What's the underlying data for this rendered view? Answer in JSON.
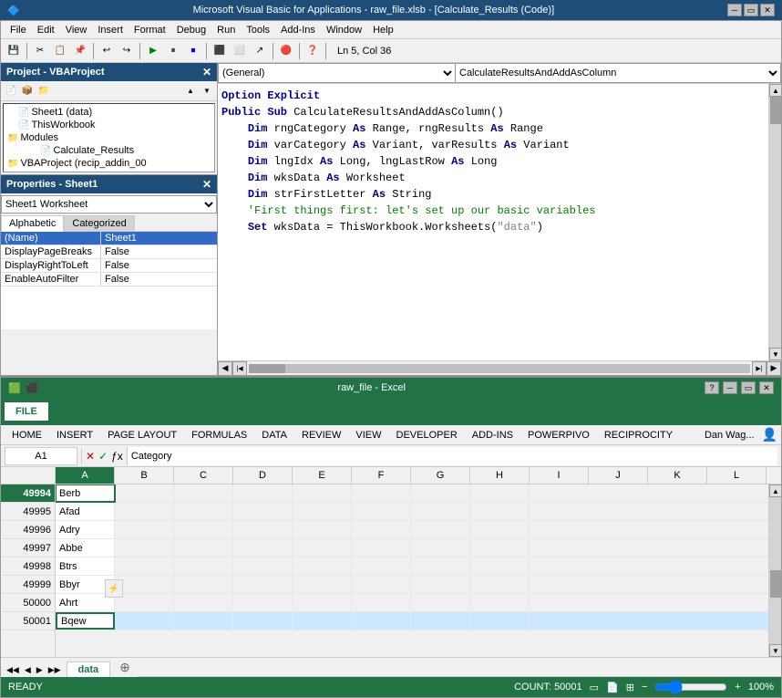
{
  "titlebar": {
    "text": "Microsoft Visual Basic for Applications - raw_file.xlsb - [Calculate_Results (Code)]",
    "controls": [
      "minimize",
      "restore",
      "close"
    ]
  },
  "vba": {
    "menubar": {
      "items": [
        "File",
        "Edit",
        "View",
        "Insert",
        "Format",
        "Debug",
        "Run",
        "Tools",
        "Add-Ins",
        "Window",
        "Help"
      ]
    },
    "toolbar": {
      "status": "Ln 5, Col 36"
    },
    "project_panel": {
      "title": "Project - VBAProject",
      "tree": [
        {
          "label": "Sheet1 (data)",
          "indent": 1,
          "icon": "📄"
        },
        {
          "label": "ThisWorkbook",
          "indent": 1,
          "icon": "📄"
        },
        {
          "label": "Modules",
          "indent": 0,
          "icon": "📁"
        },
        {
          "label": "Calculate_Results",
          "indent": 2,
          "icon": "📄"
        },
        {
          "label": "VBAProject (recip_addin_00",
          "indent": 0,
          "icon": "📁"
        }
      ]
    },
    "properties_panel": {
      "title": "Properties - Sheet1",
      "dropdown": "Sheet1  Worksheet",
      "tabs": [
        "Alphabetic",
        "Categorized"
      ],
      "active_tab": "Alphabetic",
      "rows": [
        {
          "name": "(Name)",
          "value": "Sheet1",
          "selected": true
        },
        {
          "name": "DisplayPageBreaks",
          "value": "False"
        },
        {
          "name": "DisplayRightToLeft",
          "value": "False"
        },
        {
          "name": "EnableAutoFilter",
          "value": "False"
        }
      ]
    },
    "code_editor": {
      "dropdown_left": "(General)",
      "dropdown_right": "CalculateResultsAndAddAsColumn",
      "lines": [
        {
          "text": "Option Explicit",
          "type": "keyword"
        },
        {
          "text": "Public Sub CalculateResultsAndAddAsColumn()",
          "type": "mixed"
        },
        {
          "text": "",
          "type": "normal"
        },
        {
          "text": "    Dim rngCategory As Range, rngResults As Range",
          "type": "mixed"
        },
        {
          "text": "    Dim varCategory As Variant, varResults As Variant",
          "type": "mixed"
        },
        {
          "text": "    Dim lngIdx As Long, lngLastRow As Long",
          "type": "mixed"
        },
        {
          "text": "    Dim wksData As Worksheet",
          "type": "mixed"
        },
        {
          "text": "    Dim strFirstLetter As String",
          "type": "mixed"
        },
        {
          "text": "",
          "type": "normal"
        },
        {
          "text": "    'First things first: let's set up our basic variables",
          "type": "comment"
        },
        {
          "text": "    Set wksData = ThisWorkbook.Worksheets(\"data\")",
          "type": "mixed"
        }
      ]
    }
  },
  "excel": {
    "titlebar": {
      "text": "raw_file - Excel",
      "controls": [
        "minimize",
        "restore",
        "close"
      ]
    },
    "ribbon_tabs": [
      "FILE",
      "HOME",
      "INSERT",
      "PAGE LAYOUT",
      "FORMULAS",
      "DATA",
      "REVIEW",
      "VIEW",
      "DEVELOPER",
      "ADD-INS",
      "POWERPIVO",
      "RECIPROCITY"
    ],
    "user": "Dan Wag...",
    "formula_bar": {
      "name_box": "A1",
      "formula": "Category"
    },
    "col_headers": [
      "A",
      "B",
      "C",
      "D",
      "E",
      "F",
      "G",
      "H",
      "I",
      "J",
      "K",
      "L"
    ],
    "rows": [
      {
        "num": "49994",
        "a": "Berb"
      },
      {
        "num": "49995",
        "a": "Afad"
      },
      {
        "num": "49996",
        "a": "Adry"
      },
      {
        "num": "49997",
        "a": "Abbe"
      },
      {
        "num": "49998",
        "a": "Btrs"
      },
      {
        "num": "49999",
        "a": "Bbyr"
      },
      {
        "num": "50000",
        "a": "Ahrt"
      },
      {
        "num": "50001",
        "a": "Bqew",
        "active": true
      }
    ],
    "sheet_tabs": [
      "data"
    ],
    "active_sheet": "data",
    "status": {
      "left": "READY",
      "count": "COUNT: 50001",
      "zoom": "100%"
    }
  }
}
